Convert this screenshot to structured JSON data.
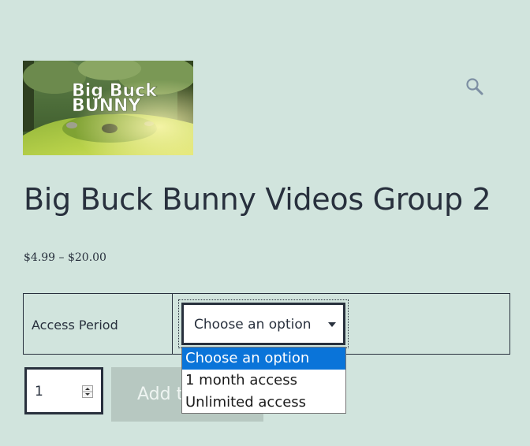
{
  "product": {
    "thumbnail_text": [
      "Big Buck",
      "BUNNY"
    ],
    "title": "Big Buck Bunny Videos Group 2",
    "price": "$4.99 – $20.00"
  },
  "variations": {
    "label": "Access Period",
    "selected": "Choose an option",
    "options": [
      {
        "label": "Choose an option",
        "highlighted": true
      },
      {
        "label": "1 month access",
        "highlighted": false
      },
      {
        "label": "Unlimited access",
        "highlighted": false
      }
    ]
  },
  "quantity": {
    "value": "1"
  },
  "add_to_cart": {
    "label": "Add to cart"
  },
  "icons": {
    "search": "search-icon",
    "dropdown": "chevron-down-icon",
    "spinner": "spinner-arrows-icon"
  },
  "colors": {
    "background": "#d1e4dd",
    "text": "#28303d",
    "highlight": "#0a74d9",
    "button_disabled": "#b7c8c1"
  }
}
